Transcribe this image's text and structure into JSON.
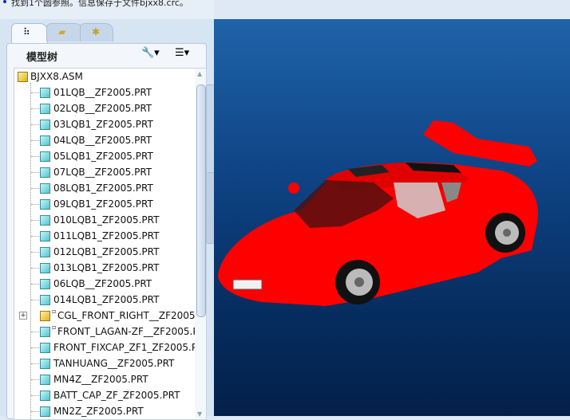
{
  "status": {
    "message": "找到1个圆参照。信息保存于文件bjxx8.crc。"
  },
  "tabs": [
    {
      "name": "model-tree",
      "icon": "tree-icon"
    },
    {
      "name": "folder-browser",
      "icon": "folders-icon"
    },
    {
      "name": "favorites",
      "icon": "star-folder-icon"
    }
  ],
  "panel": {
    "title": "模型树",
    "tools_icon": "hammer-wrench-icon",
    "settings_icon": "list-settings-icon"
  },
  "tree": {
    "root": "BJXX8.ASM",
    "items": [
      {
        "label": "01LQB__ZF2005.PRT",
        "type": "part"
      },
      {
        "label": "02LQB__ZF2005.PRT",
        "type": "part"
      },
      {
        "label": "03LQB1_ZF2005.PRT",
        "type": "part"
      },
      {
        "label": "04LQB__ZF2005.PRT",
        "type": "part"
      },
      {
        "label": "05LQB1_ZF2005.PRT",
        "type": "part"
      },
      {
        "label": "07LQB__ZF2005.PRT",
        "type": "part"
      },
      {
        "label": "08LQB1_ZF2005.PRT",
        "type": "part"
      },
      {
        "label": "09LQB1_ZF2005.PRT",
        "type": "part"
      },
      {
        "label": "010LQB1_ZF2005.PRT",
        "type": "part"
      },
      {
        "label": "011LQB1_ZF2005.PRT",
        "type": "part"
      },
      {
        "label": "012LQB1_ZF2005.PRT",
        "type": "part"
      },
      {
        "label": "013LQB1_ZF2005.PRT",
        "type": "part"
      },
      {
        "label": "06LQB__ZF2005.PRT",
        "type": "part"
      },
      {
        "label": "014LQB1_ZF2005.PRT",
        "type": "part"
      },
      {
        "label": "CGL_FRONT_RIGHT__ZF2005",
        "type": "asm"
      },
      {
        "label": "FRONT_LAGAN-ZF__ZF2005.P",
        "type": "part",
        "flag": true
      },
      {
        "label": "FRONT_FIXCAP_ZF1_ZF2005.P",
        "type": "part"
      },
      {
        "label": "TANHUANG__ZF2005.PRT",
        "type": "part"
      },
      {
        "label": "MN4Z__ZF2005.PRT",
        "type": "part"
      },
      {
        "label": "BATT_CAP_ZF_ZF2005.PRT",
        "type": "part"
      },
      {
        "label": "MN2Z_ZF2005.PRT",
        "type": "part"
      }
    ]
  },
  "viewport": {
    "model_color": "#ff0000",
    "bg_top": "#1f63a8",
    "bg_bottom": "#03204a"
  }
}
